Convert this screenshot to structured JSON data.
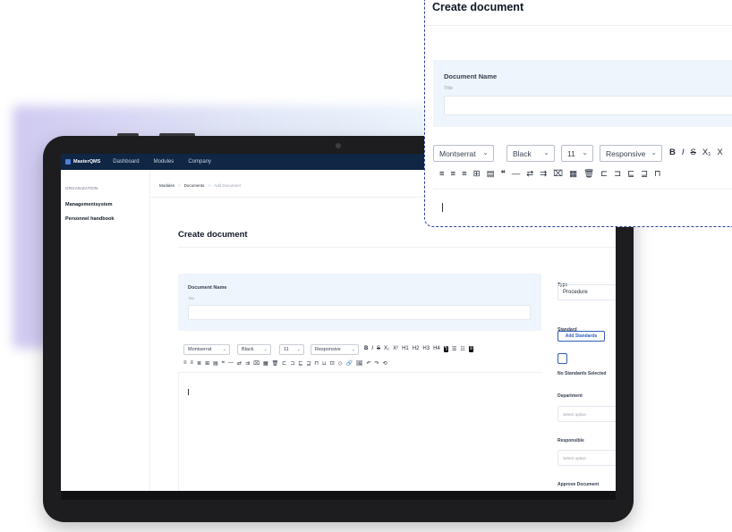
{
  "app": {
    "brand": "MasterQMS",
    "nav": [
      "Dashboard",
      "Modules",
      "Company"
    ]
  },
  "sidebar": {
    "heading": "ORGANIZATION",
    "items": [
      {
        "label": "Managementsystem"
      },
      {
        "label": "Personnel handbook"
      }
    ]
  },
  "breadcrumb": {
    "items": [
      "Modules",
      "Documents",
      "Add Document"
    ],
    "separator": ">"
  },
  "page": {
    "title": "Create document",
    "document_name_label": "Document Name",
    "title_label": "Title",
    "title_value": ""
  },
  "toolbar": {
    "font": "Montserrat",
    "color": "Black",
    "size": "11",
    "width": "Responsive",
    "row1_marks": [
      "B",
      "I",
      "S",
      "X₁",
      "X²",
      "H1",
      "H2",
      "H3",
      "H4"
    ],
    "row1_glyphs": [
      "¶",
      "☰",
      "☷",
      "≡"
    ],
    "row2_glyphs": [
      "≡",
      "≡",
      "≣",
      "⊞",
      "▤",
      "❝",
      "—",
      "⇄",
      "⇉",
      "⌧",
      "▦",
      "🗑",
      "⊏",
      "⊐",
      "⊑",
      "⊒",
      "⊓",
      "⊔",
      "⊡",
      "◇",
      "🔗",
      "🖼",
      "↶",
      "↷",
      "⟲"
    ]
  },
  "right_panel": {
    "type_label": "Type",
    "type_value": "Procedure",
    "standard_label": "Standard",
    "add_standards": "Add Standards",
    "no_standards": "No Standards Selected",
    "department_label": "Department",
    "department_placeholder": "Select option",
    "responsible_label": "Responsible",
    "responsible_placeholder": "Select option",
    "approve_label": "Approve Document"
  },
  "zoom": {
    "title": "Create document",
    "document_name_label": "Document Name",
    "title_label": "Title",
    "font": "Montserrat",
    "color": "Black",
    "size": "11",
    "width": "Responsive",
    "marks": [
      "B",
      "I",
      "S",
      "X₁",
      "X"
    ],
    "row2_glyphs": [
      "≡",
      "≡",
      "≡",
      "⊞",
      "▤",
      "❝",
      "—",
      "⇄",
      "⇉",
      "⌧",
      "▦",
      "🗑",
      "⊏",
      "⊐",
      "⊑",
      "⊒",
      "⊓"
    ]
  },
  "colors": {
    "nav_bg": "#0f2644",
    "accent": "#2f5fb8",
    "panel_bg": "#eef5fc",
    "zoom_border": "#2d3e91"
  }
}
